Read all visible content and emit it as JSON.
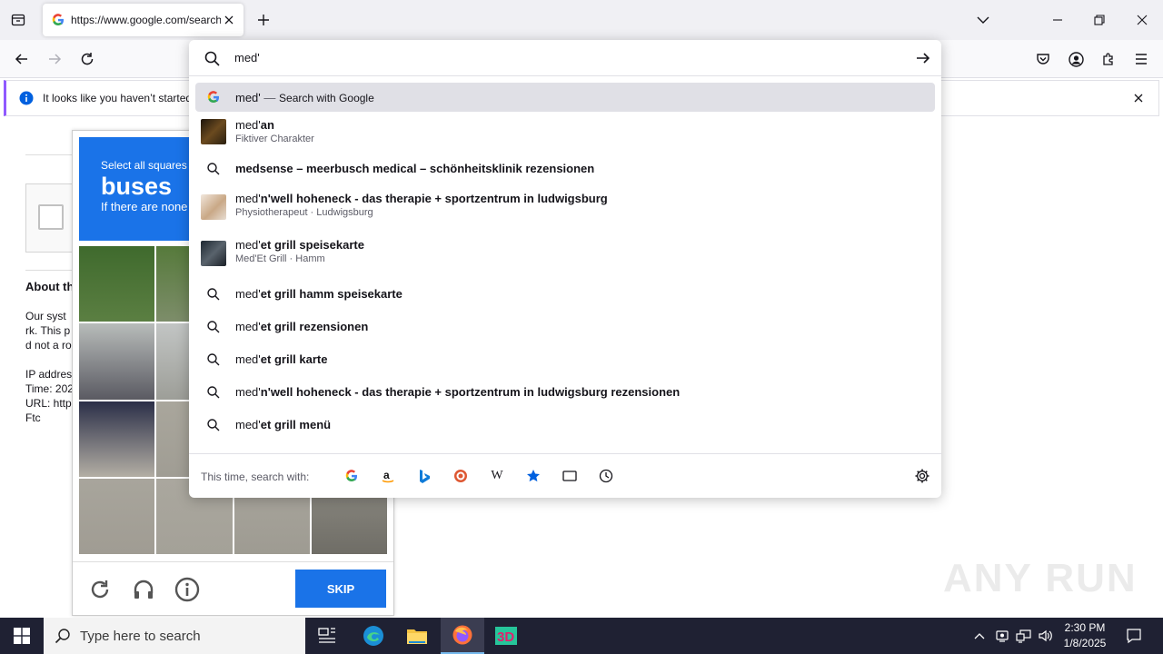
{
  "browser": {
    "tab_title": "https://www.google.com/search",
    "notification": "It looks like you haven’t started"
  },
  "page": {
    "about_heading": "About th",
    "lines1": [
      "Our syst",
      "rk. This p",
      "d not a ro"
    ],
    "lines2": [
      "IP addres",
      "Time: 202",
      "URL: http",
      "Ftc"
    ]
  },
  "captcha": {
    "instruction_small": "Select all squares",
    "target": "buses",
    "hint": "If there are none",
    "skip_label": "SKIP"
  },
  "urlbar": {
    "query": "med'",
    "results": [
      {
        "type": "search-engine",
        "text": "med'",
        "action": "Search with Google",
        "selected": true
      },
      {
        "type": "entity",
        "prefix": "med'",
        "bold": "an",
        "sub": "Fiktiver Charakter",
        "thumb": "#3a2a14"
      },
      {
        "type": "suggestion",
        "prefix": "",
        "bold": "medsense – meerbusch medical – schönheitsklinik rezensionen"
      },
      {
        "type": "entity",
        "prefix": "med'",
        "bold": "n'well hoheneck - das therapie + sportzentrum in ludwigsburg",
        "sub": "Physiotherapeut · Ludwigsburg",
        "thumb": "#d9c8b5"
      },
      {
        "type": "entity",
        "prefix": "med'",
        "bold": "et grill speisekarte",
        "sub": "Med'Et Grill · Hamm",
        "thumb": "#2e3a48"
      },
      {
        "type": "suggestion",
        "prefix": "med'",
        "bold": "et grill hamm speisekarte"
      },
      {
        "type": "suggestion",
        "prefix": "med'",
        "bold": "et grill rezensionen"
      },
      {
        "type": "suggestion",
        "prefix": "med'",
        "bold": "et grill karte"
      },
      {
        "type": "suggestion",
        "prefix": "med'",
        "bold": "n'well hoheneck - das therapie + sportzentrum in ludwigsburg rezensionen"
      },
      {
        "type": "suggestion",
        "prefix": "med'",
        "bold": "et grill menü"
      }
    ],
    "oneoff_label": "This time, search with:",
    "engines": [
      "google-icon",
      "amazon-icon",
      "bing-icon",
      "duckduckgo-icon",
      "wikipedia-icon",
      "bookmarks-icon",
      "tabs-icon",
      "history-icon"
    ]
  },
  "watermark": "ANY RUN",
  "taskbar": {
    "search_placeholder": "Type here to search",
    "time": "2:30 PM",
    "date": "1/8/2025"
  }
}
